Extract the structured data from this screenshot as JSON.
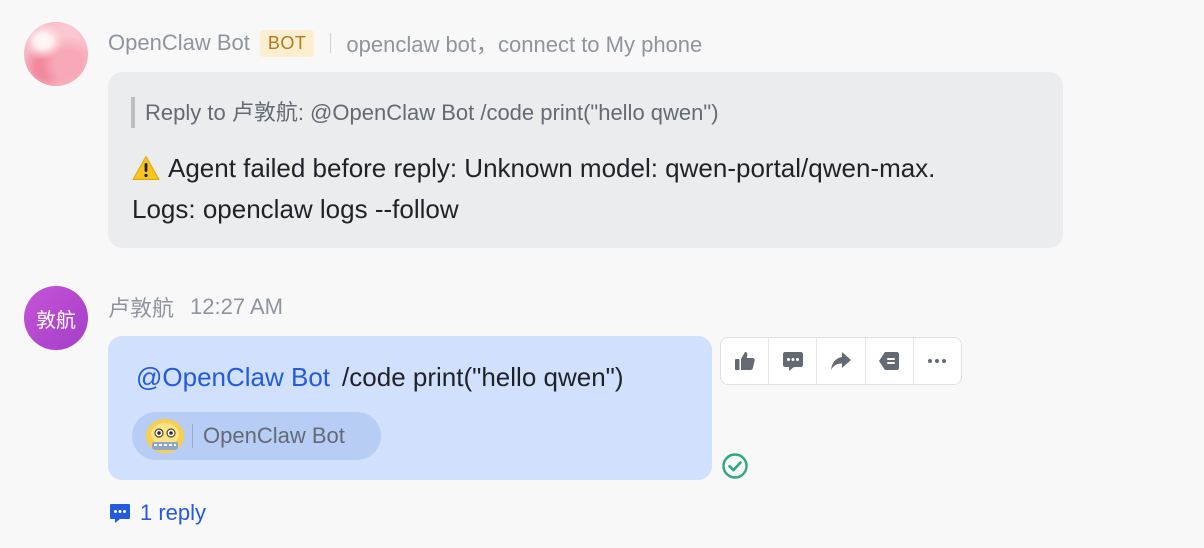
{
  "messages": [
    {
      "sender": "OpenClaw Bot",
      "badge": "BOT",
      "subtitle": "openclaw bot，connect to My phone",
      "quote": "Reply to 卢敦航:  @OpenClaw Bot /code print(\"hello qwen\")",
      "line1": "Agent failed before reply: Unknown model: qwen-portal/qwen-max.",
      "line2": "Logs: openclaw logs --follow",
      "avatar_icon": "peach-avatar-icon",
      "warning_icon": "warning-icon"
    },
    {
      "sender": "卢敦航",
      "time": "12:27 AM",
      "avatar_text": "敦航",
      "mention": "@OpenClaw Bot",
      "text": "/code print(\"hello qwen\")",
      "bot_chip": "OpenClaw Bot",
      "read_status_icon": "check-circle-icon"
    }
  ],
  "toolbar": {
    "actions": [
      "thumbs-up-icon",
      "comment-icon",
      "forward-icon",
      "quote-reply-icon",
      "more-icon"
    ]
  },
  "reply": {
    "label": "1 reply",
    "icon": "thread-reply-icon"
  },
  "colors": {
    "accent": "#245bdb",
    "user_bubble": "#d1e0fc",
    "bot_bubble": "#ebecee",
    "badge_bg": "#fcefcf",
    "badge_text": "#b7781d",
    "read_check": "#2ea97a"
  }
}
